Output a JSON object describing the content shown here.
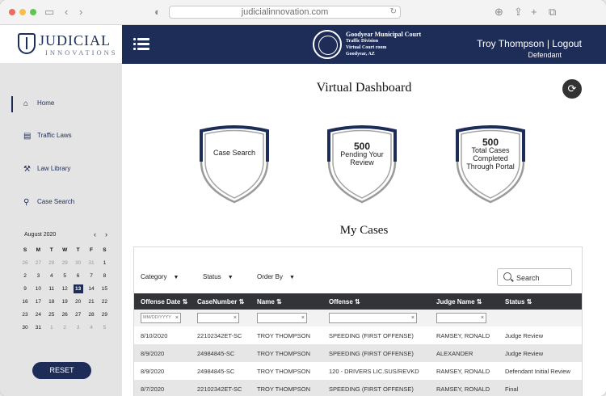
{
  "browser": {
    "url": "judicialinnovation.com"
  },
  "logo": {
    "line1": "JUDICIAL",
    "line2": "INNOVATIONS"
  },
  "court": {
    "name": "Goodyear Municipal Court",
    "division": "Traffic Division",
    "room": "Virtual Court room",
    "city": "Goodyear, AZ"
  },
  "user": {
    "name": "Troy Thompson",
    "separator": "|",
    "logout": "Logout",
    "role": "Defendant"
  },
  "nav": [
    {
      "label": "Home",
      "icon": "home-icon"
    },
    {
      "label": "Traffic Laws",
      "icon": "document-icon"
    },
    {
      "label": "Law Library",
      "icon": "gavel-icon"
    },
    {
      "label": "Case Search",
      "icon": "search-case-icon"
    }
  ],
  "calendar": {
    "month": "August 2020",
    "weekdays": [
      "S",
      "M",
      "T",
      "W",
      "T",
      "F",
      "S"
    ],
    "weeks": [
      [
        "26",
        "27",
        "28",
        "29",
        "30",
        "31",
        "1"
      ],
      [
        "2",
        "3",
        "4",
        "5",
        "6",
        "7",
        "8"
      ],
      [
        "9",
        "10",
        "11",
        "12",
        "13",
        "14",
        "15"
      ],
      [
        "16",
        "17",
        "18",
        "19",
        "20",
        "21",
        "22"
      ],
      [
        "23",
        "24",
        "25",
        "26",
        "27",
        "28",
        "29"
      ],
      [
        "30",
        "31",
        "1",
        "2",
        "3",
        "4",
        "5"
      ]
    ],
    "selected": "13"
  },
  "reset_label": "RESET",
  "dashboard": {
    "title": "Virtual Dashboard",
    "badges": [
      {
        "number": "",
        "label": "Case Search"
      },
      {
        "number": "500",
        "label": "Pending Your Review"
      },
      {
        "number": "500",
        "label": "Total Cases Completed Through Portal"
      }
    ]
  },
  "cases": {
    "title": "My Cases",
    "filters": [
      "Category",
      "Status",
      "Order By"
    ],
    "search_label": "Search",
    "columns": [
      "Offense Date",
      "CaseNumber",
      "Name",
      "Offense",
      "Judge Name",
      "Status"
    ],
    "date_placeholder": "MM/DD/YYYY",
    "rows": [
      [
        "8/10/2020",
        "22102342ET-SC",
        "TROY THOMPSON",
        "SPEEDING (FIRST OFFENSE)",
        "RAMSEY, RONALD",
        "Judge Review"
      ],
      [
        "8/9/2020",
        "24984845-SC",
        "TROY THOMPSON",
        "SPEEDING (FIRST OFFENSE)",
        "ALEXANDER",
        "Judge Review"
      ],
      [
        "8/9/2020",
        "24984845-SC",
        "TROY THOMPSON",
        "120 - DRIVERS LIC.SUS/REVKD",
        "RAMSEY, RONALD",
        "Defendant Initial Review"
      ],
      [
        "8/7/2020",
        "22102342ET-SC",
        "TROY THOMPSON",
        "SPEEDING (FIRST OFFENSE)",
        "RAMSEY, RONALD",
        "Final"
      ]
    ]
  }
}
